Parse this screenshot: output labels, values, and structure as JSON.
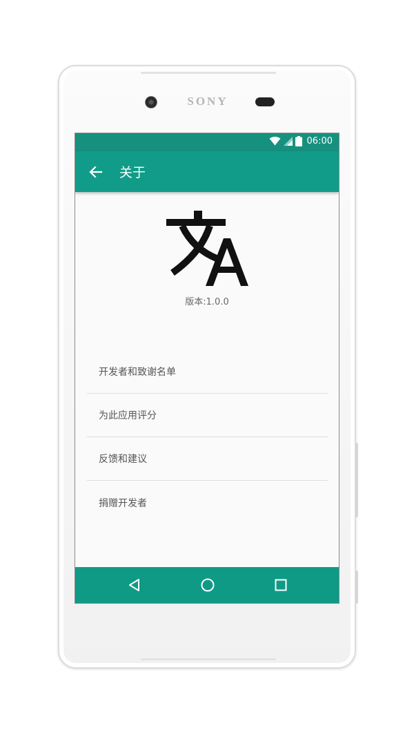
{
  "device": {
    "brand": "SONY"
  },
  "status_bar": {
    "time": "06:00",
    "icons": [
      "wifi-icon",
      "signal-icon",
      "battery-icon"
    ]
  },
  "toolbar": {
    "title": "关于",
    "back_icon": "arrow-left-icon"
  },
  "about": {
    "logo_icon": "translate-icon",
    "version": "版本:1.0.0"
  },
  "menu": {
    "items": [
      {
        "label": "开发者和致谢名单"
      },
      {
        "label": "为此应用评分"
      },
      {
        "label": "反馈和建议"
      },
      {
        "label": "捐赠开发者"
      }
    ]
  },
  "navbar": {
    "icons": [
      "back-triangle-icon",
      "home-circle-icon",
      "recents-square-icon"
    ]
  },
  "colors": {
    "primary": "#119c89",
    "status": "#17917f",
    "background": "#fafafa"
  }
}
